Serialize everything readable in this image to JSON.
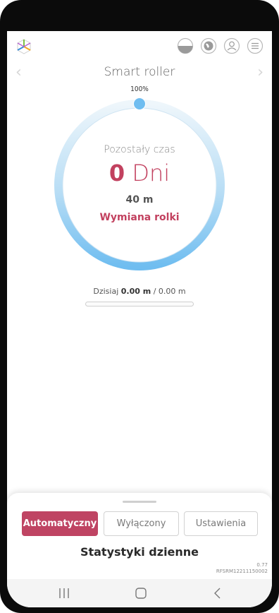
{
  "app": {
    "device_title": "Smart roller",
    "percent_label": "100%"
  },
  "header": {
    "icons": [
      "app-logo-icon",
      "half-circle-icon",
      "globe-icon",
      "user-icon",
      "menu-icon"
    ]
  },
  "gauge": {
    "level_fraction": 1.0,
    "remaining_label": "Pozostały czas",
    "days_value": "0",
    "days_unit": "Dni",
    "meters": "40 m",
    "action": "Wymiana rolki"
  },
  "today": {
    "label": "Dzisiaj",
    "value": "0.00 m",
    "separator": "/",
    "total": "0.00 m",
    "progress_fraction": 0.0
  },
  "sheet": {
    "modes": [
      {
        "label": "Automatyczny",
        "active": true
      },
      {
        "label": "Wyłączony",
        "active": false
      },
      {
        "label": "Ustawienia",
        "active": false
      }
    ],
    "stats_title": "Statystyki dzienne",
    "version": "0.77",
    "serial": "RFSRM12211150002"
  },
  "colors": {
    "accent": "#bf4463",
    "gauge_light": "#e6f2fa",
    "gauge_dark": "#7ec8f0",
    "knob": "#6fbdf0"
  }
}
